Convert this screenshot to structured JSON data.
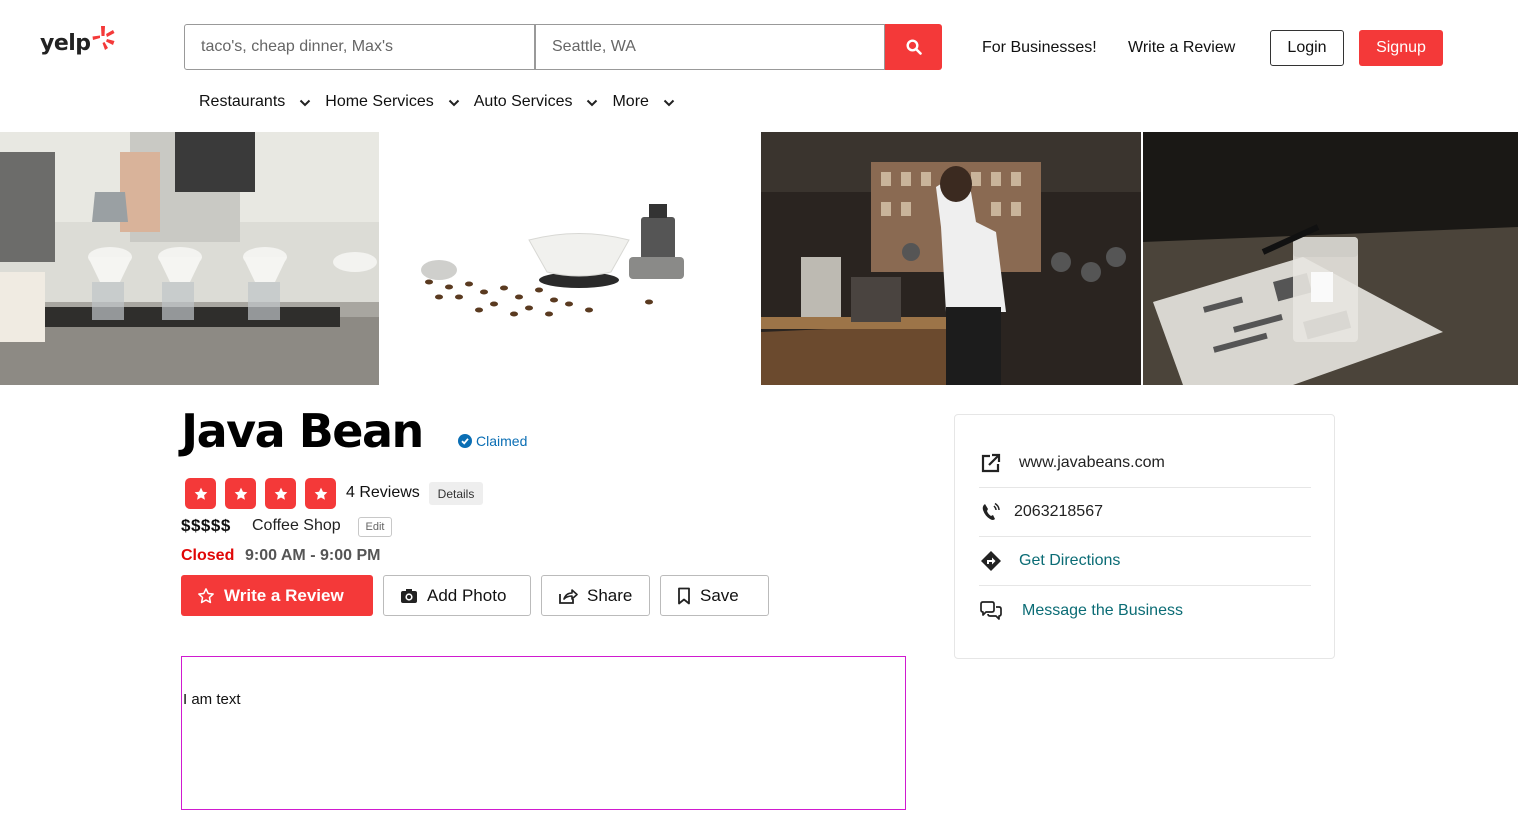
{
  "header": {
    "logo_text": "yelp",
    "search_placeholder": "taco's, cheap dinner, Max's",
    "location_placeholder": "Seattle, WA",
    "for_businesses": "For Businesses!",
    "write_review": "Write a Review",
    "login": "Login",
    "signup": "Signup"
  },
  "nav": {
    "items": [
      "Restaurants",
      "Home Services",
      "Auto Services",
      "More"
    ]
  },
  "business": {
    "name": "Java Bean",
    "claimed": "Claimed",
    "rating": 4,
    "rating_max": 4,
    "reviews": "4 Reviews",
    "details": "Details",
    "price": "$$$$$",
    "category": "Coffee Shop",
    "edit": "Edit",
    "status": "Closed",
    "hours": "9:00 AM - 9:00 PM"
  },
  "actions": {
    "write_review": "Write a Review",
    "add_photo": "Add Photo",
    "share": "Share",
    "save": "Save"
  },
  "text_box": {
    "text": "I am text"
  },
  "sidebar": {
    "website": "www.javabeans.com",
    "phone": "2063218567",
    "directions": "Get Directions",
    "message": "Message the Business"
  },
  "colors": {
    "brand_red": "#f43939",
    "closed_red": "#e00707",
    "link_teal": "#0b6c75",
    "claimed_blue": "#0a6eb4"
  }
}
